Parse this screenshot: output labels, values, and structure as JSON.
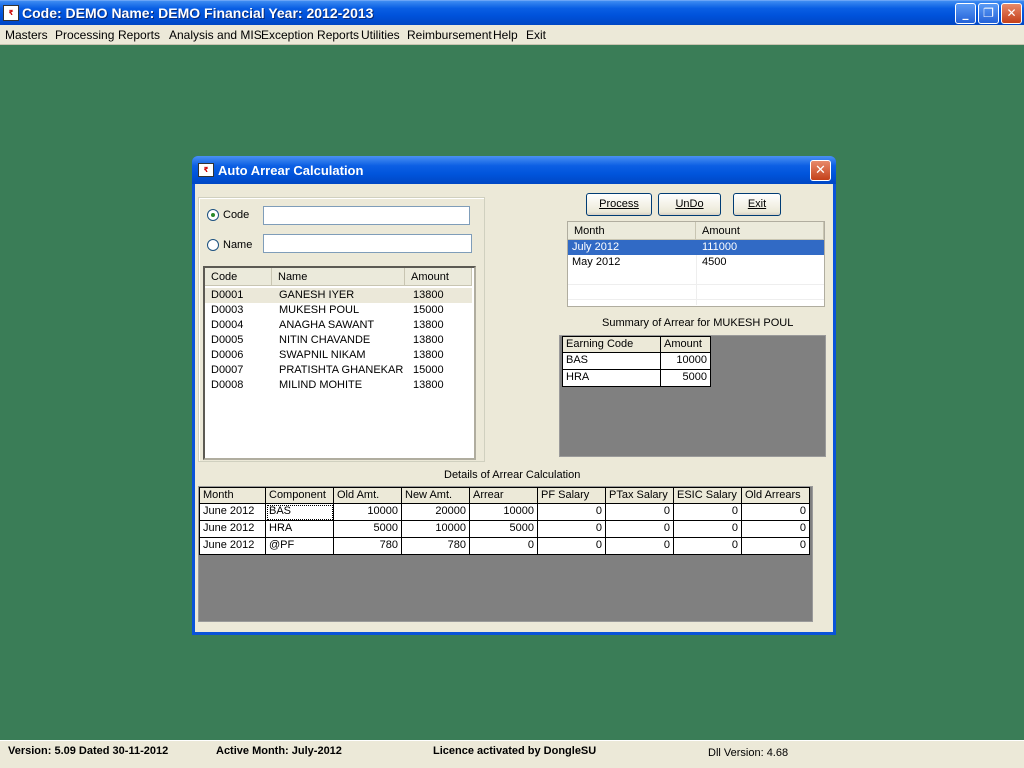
{
  "app": {
    "title": "Code: DEMO Name: DEMO Financial Year: 2012-2013",
    "icon_text": "₹"
  },
  "menu": [
    "Masters",
    "Processing",
    "Reports",
    "Analysis and MIS",
    "Exception Reports",
    "Utilities",
    "Reimbursement",
    "Help",
    "Exit"
  ],
  "status": {
    "version": "Version: 5.09 Dated 30-11-2012",
    "active_month": "Active Month: July-2012",
    "licence": "Licence activated by DongleSU",
    "dll_version": "Dll Version: 4.68"
  },
  "dialog": {
    "title": "Auto Arrear Calculation",
    "search": {
      "code_label": "Code",
      "name_label": "Name",
      "code_value": "",
      "name_value": "",
      "selected": "Code"
    },
    "employee_list": {
      "headers": [
        "Code",
        "Name",
        "Amount"
      ],
      "rows": [
        [
          "D0001",
          "GANESH IYER",
          "13800"
        ],
        [
          "D0003",
          "MUKESH POUL",
          "15000"
        ],
        [
          "D0004",
          "ANAGHA SAWANT",
          "13800"
        ],
        [
          "D0005",
          "NITIN CHAVANDE",
          "13800"
        ],
        [
          "D0006",
          "SWAPNIL NIKAM",
          "13800"
        ],
        [
          "D0007",
          "PRATISHTA GHANEKAR",
          "15000"
        ],
        [
          "D0008",
          "MILIND MOHITE",
          "13800"
        ]
      ],
      "highlighted_row": 0
    },
    "buttons": {
      "process": "Process",
      "undo": "UnDo",
      "exit": "Exit"
    },
    "month_list": {
      "headers": [
        "Month",
        "Amount"
      ],
      "rows": [
        [
          "July 2012",
          "111000"
        ],
        [
          "May 2012",
          "4500"
        ]
      ],
      "selected_row": 0
    },
    "summary": {
      "caption": "Summary of Arrear for MUKESH POUL",
      "headers": [
        "Earning Code",
        "Amount"
      ],
      "rows": [
        [
          "BAS",
          "10000"
        ],
        [
          "HRA",
          "5000"
        ]
      ]
    },
    "details": {
      "caption": "Details of Arrear Calculation",
      "headers": [
        "Month",
        "Component",
        "Old Amt.",
        "New Amt.",
        "Arrear",
        "PF Salary",
        "PTax Salary",
        "ESIC Salary",
        "Old Arrears"
      ],
      "rows": [
        [
          "June 2012",
          "BAS",
          "10000",
          "20000",
          "10000",
          "0",
          "0",
          "0",
          "0"
        ],
        [
          "June 2012",
          "HRA",
          "5000",
          "10000",
          "5000",
          "0",
          "0",
          "0",
          "0"
        ],
        [
          "June 2012",
          "@PF",
          "780",
          "780",
          "0",
          "0",
          "0",
          "0",
          "0"
        ]
      ]
    }
  },
  "colors": {
    "desktop": "#3a7d57",
    "selection": "#316ac5",
    "panel_gray": "#808080"
  }
}
